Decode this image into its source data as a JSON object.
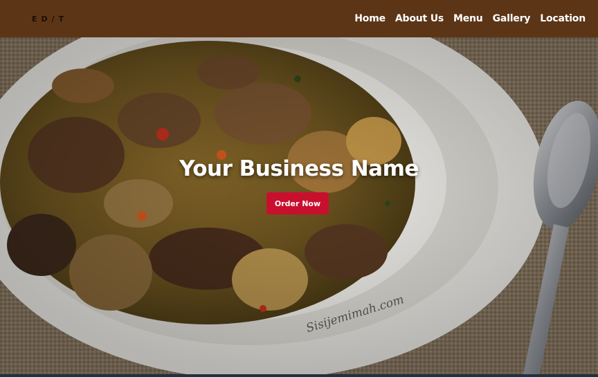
{
  "brand": {
    "logo_text": "ED/T"
  },
  "nav": {
    "items": [
      {
        "label": "Home"
      },
      {
        "label": "About Us"
      },
      {
        "label": "Menu"
      },
      {
        "label": "Gallery"
      },
      {
        "label": "Location"
      }
    ]
  },
  "hero": {
    "title": "Your Business Name",
    "cta_label": "Order Now",
    "image_watermark": "Sisijemimah.com"
  },
  "colors": {
    "navbar_bg": "#5c3516",
    "cta_bg": "#c8102e",
    "text_light": "#ffffff"
  }
}
